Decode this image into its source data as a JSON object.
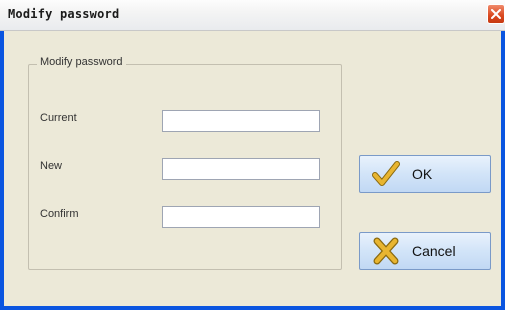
{
  "window": {
    "title": "Modify password"
  },
  "group": {
    "title": "Modify password"
  },
  "fields": [
    {
      "label": "Current",
      "value": ""
    },
    {
      "label": "New",
      "value": ""
    },
    {
      "label": "Confirm",
      "value": ""
    }
  ],
  "buttons": {
    "ok_label": "OK",
    "cancel_label": "Cancel"
  },
  "icons": {
    "close": "close-icon",
    "ok": "checkmark-icon",
    "cancel": "cross-icon"
  },
  "colors": {
    "frame": "#0a55e0",
    "close": "#d9471e",
    "face": "#ece9d8"
  }
}
